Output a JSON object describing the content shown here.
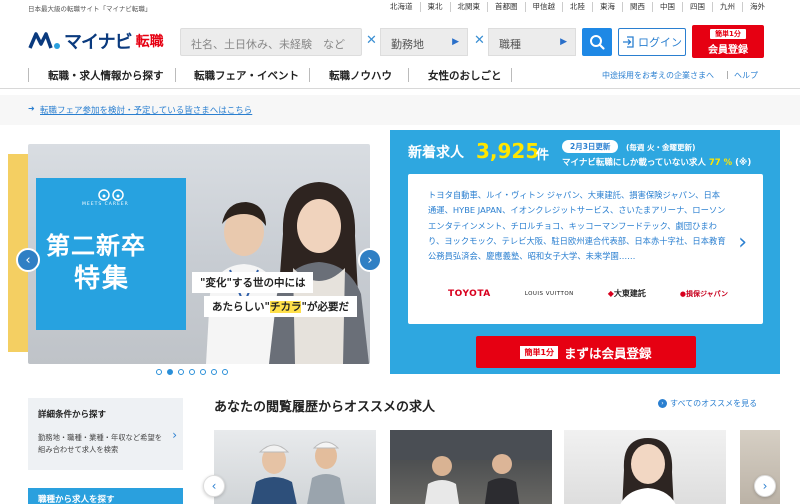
{
  "top": {
    "tagline": "日本最大級の転職サイト「マイナビ転職」",
    "regions": [
      "北海道",
      "東北",
      "北関東",
      "首都圏",
      "甲信越",
      "北陸",
      "東海",
      "関西",
      "中国",
      "四国",
      "九州",
      "海外"
    ]
  },
  "header": {
    "logo_text": "マイナビ",
    "logo_sub": "転職",
    "search_placeholder": "社名、土日休み、未経験　など",
    "location_label": "勤務地",
    "job_label": "職種",
    "login_label": "ログイン",
    "register_small": "簡単1分",
    "register_main": "会員登録"
  },
  "nav": {
    "items": [
      "転職・求人情報から探す",
      "転職フェア・イベント",
      "転職ノウハウ",
      "女性のおしごと"
    ],
    "recruiter_link": "中途採用をお考えの企業さまへ",
    "help_link": "ヘルプ"
  },
  "notice": {
    "text": "転職フェア参加を検討・予定している皆さまへはこちら"
  },
  "hero": {
    "brand_sub": "MEETS CAREER",
    "title_line1": "第二新卒",
    "title_line2": "特集",
    "caption1": "\"変化\"する世の中には",
    "caption2_pre": "あたらしい\"",
    "caption2_hl": "チカラ",
    "caption2_post": "\"が必要だ",
    "slide_count": 7,
    "active_slide": 2
  },
  "new_jobs": {
    "title": "新着求人",
    "count": "3,925",
    "unit": "件",
    "date_badge": "2月3日更新",
    "schedule": "(毎週 火・金曜更新)",
    "only_text": "マイナビ転職にしか載っていない求人",
    "only_pct": "77 %",
    "only_note": "(※)",
    "companies": "トヨタ自動車、ルイ・ヴィトン ジャパン、大東建託、損害保険ジャパン、日本通運、HYBE JAPAN、イオンクレジットサービス、さいたまアリーナ、ローソンエンタテインメント、チロルチョコ、キッコーマンフードテック、劇団ひまわり、ヨックモック、テレビ大阪、駐日欧州連合代表部、日本赤十字社、日本教育公務員弘済会、慶應義塾、昭和女子大学、未来学園……",
    "brands": [
      "TOYOTA",
      "LOUIS VUITTON",
      "大東建託",
      "損保ジャパン"
    ],
    "cta_small": "簡単1分",
    "cta_main": "まずは会員登録"
  },
  "sidebar": {
    "card1_title": "詳細条件から探す",
    "card1_desc": "勤務地・職種・業種・年収など希望を組み合わせて求人を検索",
    "card2_title": "職種から求人を探す"
  },
  "recommend": {
    "title": "あなたの閲覧履歴からオススメの求人",
    "all_link": "すべてのオススメを見る"
  }
}
